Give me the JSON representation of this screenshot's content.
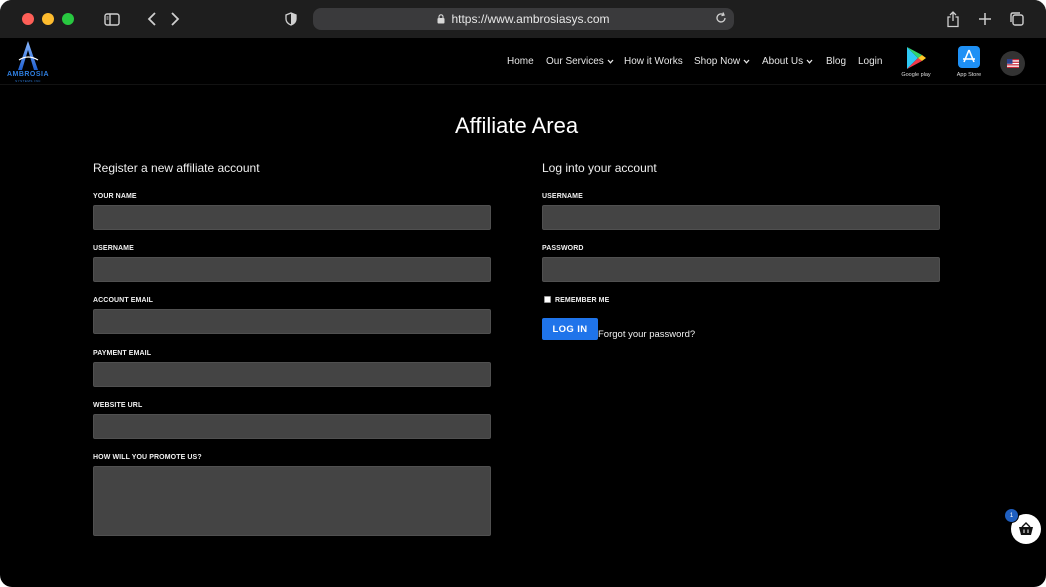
{
  "browser": {
    "url": "https://www.ambrosiasys.com"
  },
  "header": {
    "logo_text": "AMBROSIA",
    "logo_sub": "SYSTEMS INC",
    "nav": [
      {
        "label": "Home"
      },
      {
        "label": "Our Services"
      },
      {
        "label": "How it Works"
      },
      {
        "label": "Shop Now"
      },
      {
        "label": "About Us"
      },
      {
        "label": "Blog"
      },
      {
        "label": "Login"
      }
    ],
    "google_play_label": "Google play",
    "app_store_label": "App Store"
  },
  "page": {
    "title": "Affiliate Area"
  },
  "register": {
    "heading": "Register a new affiliate account",
    "your_name_label": "YOUR NAME",
    "username_label": "USERNAME",
    "account_email_label": "ACCOUNT EMAIL",
    "payment_email_label": "PAYMENT EMAIL",
    "website_url_label": "WEBSITE URL",
    "promote_label": "HOW WILL YOU PROMOTE US?"
  },
  "login": {
    "heading": "Log into your account",
    "username_label": "USERNAME",
    "password_label": "PASSWORD",
    "remember_label": "REMEMBER ME",
    "login_button": "LOG IN",
    "forgot_link": "Forgot your password?"
  },
  "cart": {
    "count": "1"
  },
  "colors": {
    "background": "#000000",
    "field": "#444444",
    "accent": "#1f74ea"
  }
}
